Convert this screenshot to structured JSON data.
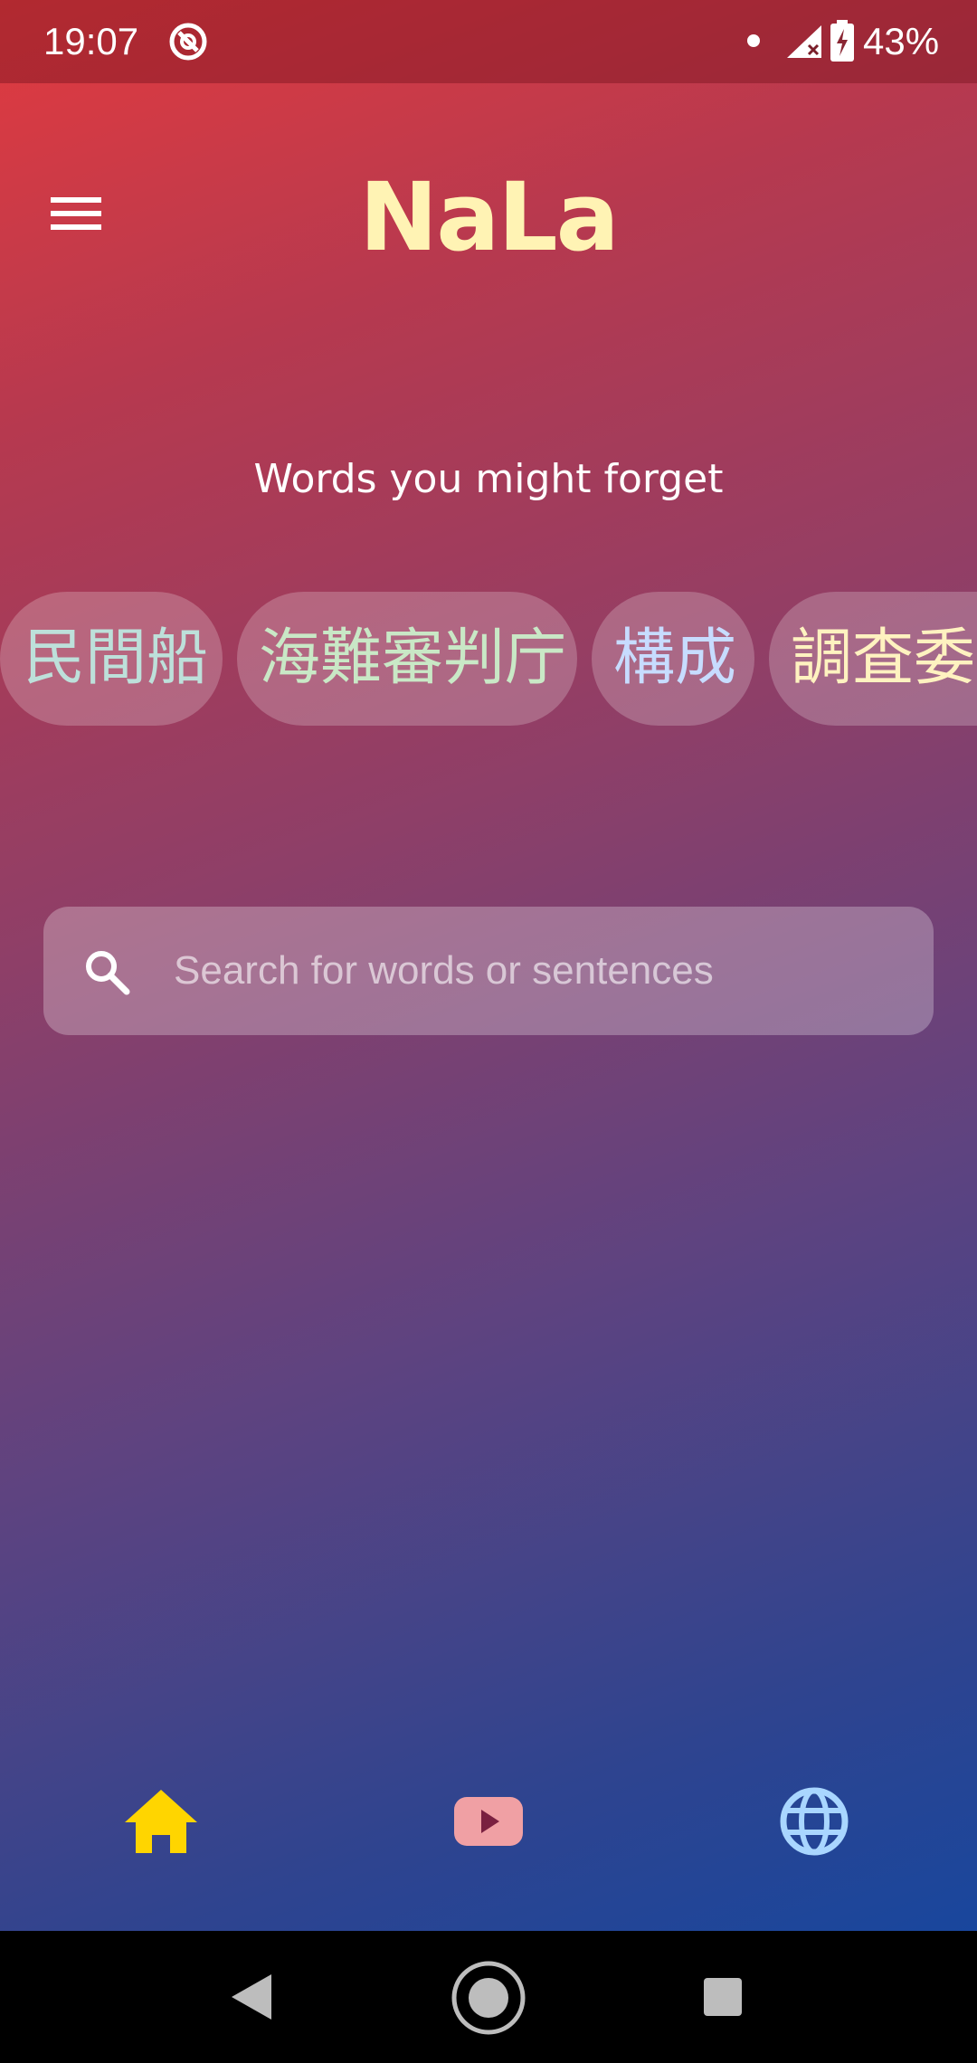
{
  "status_bar": {
    "time": "19:07",
    "battery": "43%",
    "icons": [
      "app-notification-icon",
      "dot-icon",
      "signal-icon",
      "battery-charging-icon"
    ]
  },
  "header": {
    "title": "NaLa",
    "menu_icon": "hamburger-menu-icon"
  },
  "words_section": {
    "title": "Words you might forget",
    "chips": [
      "民間船",
      "海難審判庁",
      "構成",
      "調査委員"
    ]
  },
  "search": {
    "placeholder": "Search for words or sentences",
    "icon": "search-icon"
  },
  "bottom_nav": {
    "items": [
      {
        "name": "home",
        "icon": "home-icon",
        "color": "#ffd500",
        "selected": true
      },
      {
        "name": "video",
        "icon": "play-video-icon",
        "color": "#f0a0a4",
        "selected": false
      },
      {
        "name": "web",
        "icon": "globe-icon",
        "color": "#a9d6ff",
        "selected": false
      }
    ]
  },
  "system_nav": {
    "buttons": [
      "back-icon",
      "home-circle-icon",
      "recents-icon"
    ]
  },
  "colors": {
    "title": "#fff3b4",
    "gradient_top": "#e23b3f",
    "gradient_bottom": "#0f47a3"
  }
}
